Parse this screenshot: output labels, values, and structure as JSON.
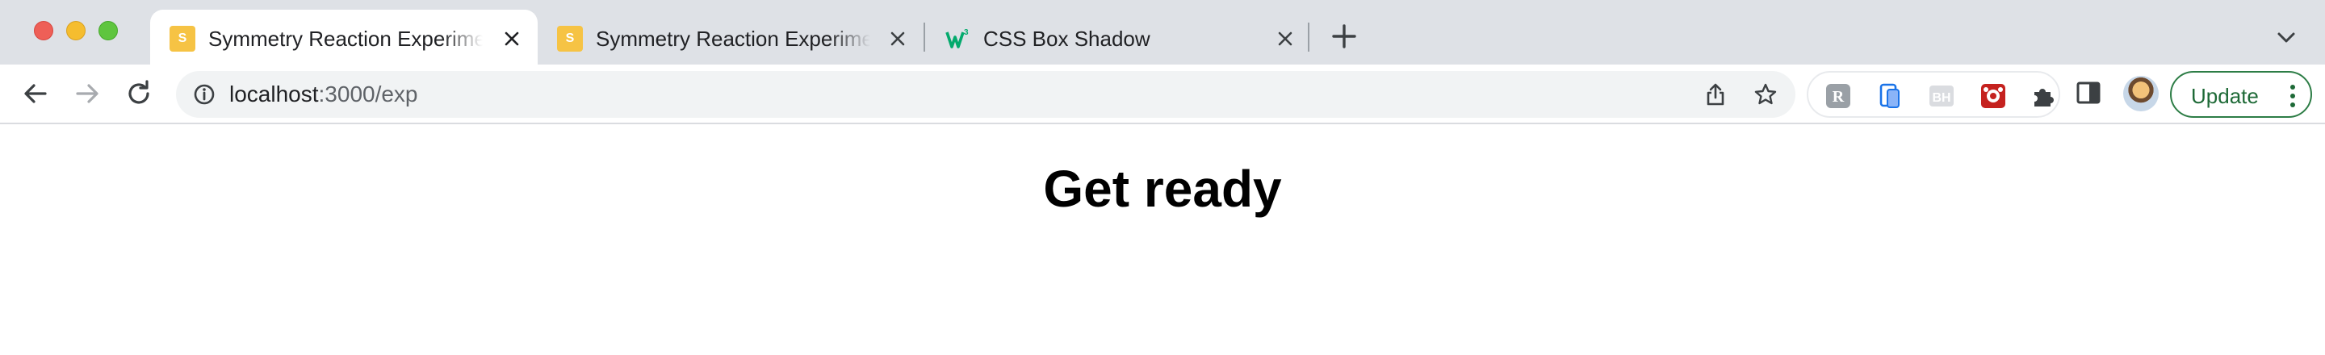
{
  "browser": {
    "tabs": [
      {
        "title": "Symmetry Reaction Experiment",
        "favicon": "S",
        "active": true
      },
      {
        "title": "Symmetry Reaction Experiment",
        "favicon": "S",
        "active": false
      },
      {
        "title": "CSS Box Shadow",
        "favicon": "w3-icon",
        "active": false
      }
    ],
    "address": {
      "host": "localhost",
      "path": ":3000/exp"
    },
    "update_label": "Update",
    "colors": {
      "accent": "#1e6a37",
      "favicon_yellow": "#f6c344",
      "tabstrip": "#dee1e6"
    }
  },
  "page": {
    "heading": "Get ready"
  }
}
